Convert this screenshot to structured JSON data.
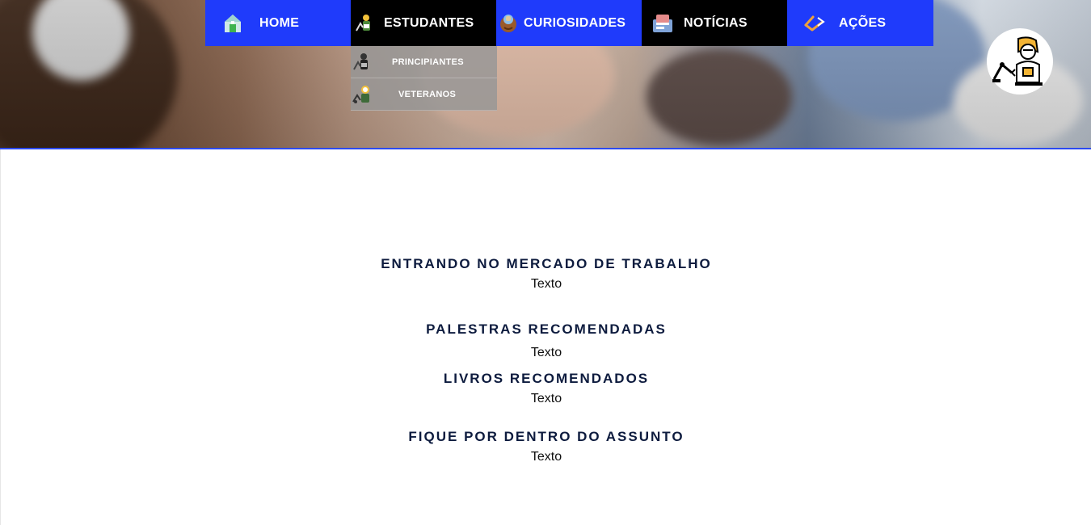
{
  "nav": {
    "items": [
      {
        "label": "HOME",
        "icon": "house-icon"
      },
      {
        "label": "ESTUDANTES",
        "icon": "student-icon"
      },
      {
        "label": "CURIOSIDADES",
        "icon": "brain-icon"
      },
      {
        "label": "NOTÍCIAS",
        "icon": "newspaper-icon"
      },
      {
        "label": "AÇÕES",
        "icon": "arrow-icon"
      }
    ],
    "dropdown": [
      {
        "label": "PRINCIPIANTES",
        "icon": "beginner-icon"
      },
      {
        "label": "VETERANOS",
        "icon": "veteran-icon"
      }
    ]
  },
  "colors": {
    "nav_blue": "#1f3bfb",
    "nav_black": "#000000",
    "title": "#0d1b3e",
    "accent_line": "#2b49f0"
  },
  "logo": {
    "icon": "engineer-robot-icon"
  },
  "sections": [
    {
      "title": "ENTRANDO NO MERCADO DE TRABALHO",
      "text": "Texto"
    },
    {
      "title": "PALESTRAS RECOMENDADAS",
      "text": "Texto"
    },
    {
      "title": "LIVROS RECOMENDADOS",
      "text": "Texto"
    },
    {
      "title": "FIQUE POR DENTRO DO ASSUNTO",
      "text": "Texto"
    }
  ]
}
